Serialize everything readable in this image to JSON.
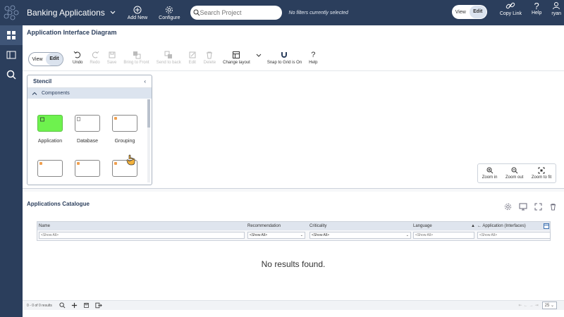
{
  "topbar": {
    "app_name": "Banking Applications",
    "add_new": "Add New",
    "configure": "Configure",
    "search_placeholder": "Search Project",
    "filters_text": "No filters currently selected",
    "view": "View",
    "edit": "Edit",
    "copy_link": "Copy Link",
    "help": "Help",
    "user": "ryan"
  },
  "sidebar": {
    "items": [
      "dashboard",
      "panel",
      "search-analytics"
    ]
  },
  "diagram": {
    "title": "Application Interface Diagram",
    "toolbar": {
      "view": "View",
      "edit": "Edit",
      "undo": "Undo",
      "redo": "Redo",
      "save": "Save",
      "bring_to_front": "Bring to Front",
      "send_to_back": "Send to back",
      "edit_tool": "Edit",
      "delete": "Delete",
      "change_layout": "Change layout",
      "snap_to_grid": "Snap to Grid is On",
      "help": "Help"
    },
    "stencil": {
      "title": "Stencil",
      "section": "Components",
      "shapes": [
        "Application",
        "Database",
        "Grouping",
        "",
        "",
        ""
      ]
    },
    "zoom": {
      "zoom_in": "Zoom in",
      "zoom_out": "Zoom out",
      "zoom_fit": "Zoom to fit"
    }
  },
  "catalogue": {
    "title": "Applications Catalogue",
    "columns": [
      "Name",
      "Recommendation",
      "Criticality",
      "Language",
      "← Application (Interfaces)"
    ],
    "filters": {
      "name": "<Show All>",
      "recommendation": "<Show All>",
      "criticality": "<Show All>",
      "language": "<Show All>",
      "interfaces": "<Show All>"
    },
    "empty": "No results found.",
    "footer": {
      "count": "0 - 0 of 0 results",
      "page_size": "25"
    }
  },
  "colors": {
    "nav": "#2b3e5c",
    "header_row": "#dfe5ee",
    "application_shape": "#6ef24e"
  }
}
